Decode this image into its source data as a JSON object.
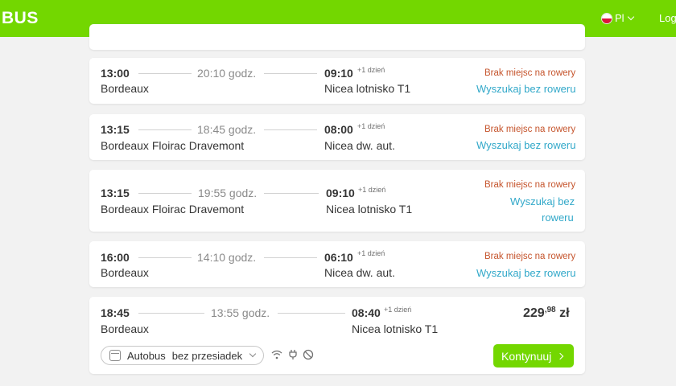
{
  "header": {
    "logo": "BUS",
    "lang": "Pl",
    "login": "Log"
  },
  "topPartial": {
    "status": ""
  },
  "common": {
    "noBikes": "Brak miejsc na rowery",
    "plusDay": "+1 dzień",
    "searchNoBike": "Wyszukaj bez roweru",
    "searchLine1": "Wyszukaj bez",
    "searchLine2": "roweru"
  },
  "trips": [
    {
      "dep": "13:00",
      "from": "Bordeaux",
      "duration": "20:10 godz.",
      "arr": "09:10",
      "to": "Nicea lotnisko T1"
    },
    {
      "dep": "13:15",
      "from": "Bordeaux Floirac Dravemont",
      "duration": "18:45 godz.",
      "arr": "08:00",
      "to": "Nicea dw. aut."
    },
    {
      "dep": "13:15",
      "from": "Bordeaux Floirac Dravemont",
      "duration": "19:55 godz.",
      "arr": "09:10",
      "to": "Nicea lotnisko T1"
    },
    {
      "dep": "16:00",
      "from": "Bordeaux",
      "duration": "14:10 godz.",
      "arr": "06:10",
      "to": "Nicea dw. aut."
    },
    {
      "dep": "18:45",
      "from": "Bordeaux",
      "duration": "13:55 godz.",
      "arr": "08:40",
      "to": "Nicea lotnisko T1",
      "price_main": "229",
      "price_cents": ",98",
      "currency": "zł",
      "transport": "Autobus",
      "transfers": "bez przesiadek",
      "button": "Kontynuuj"
    }
  ],
  "amenities": [
    "wifi-icon",
    "power-plug-icon",
    "no-smoking-icon"
  ],
  "colors": {
    "brand": "#73d700",
    "warning": "#c5542c",
    "link": "#31a8c9"
  }
}
